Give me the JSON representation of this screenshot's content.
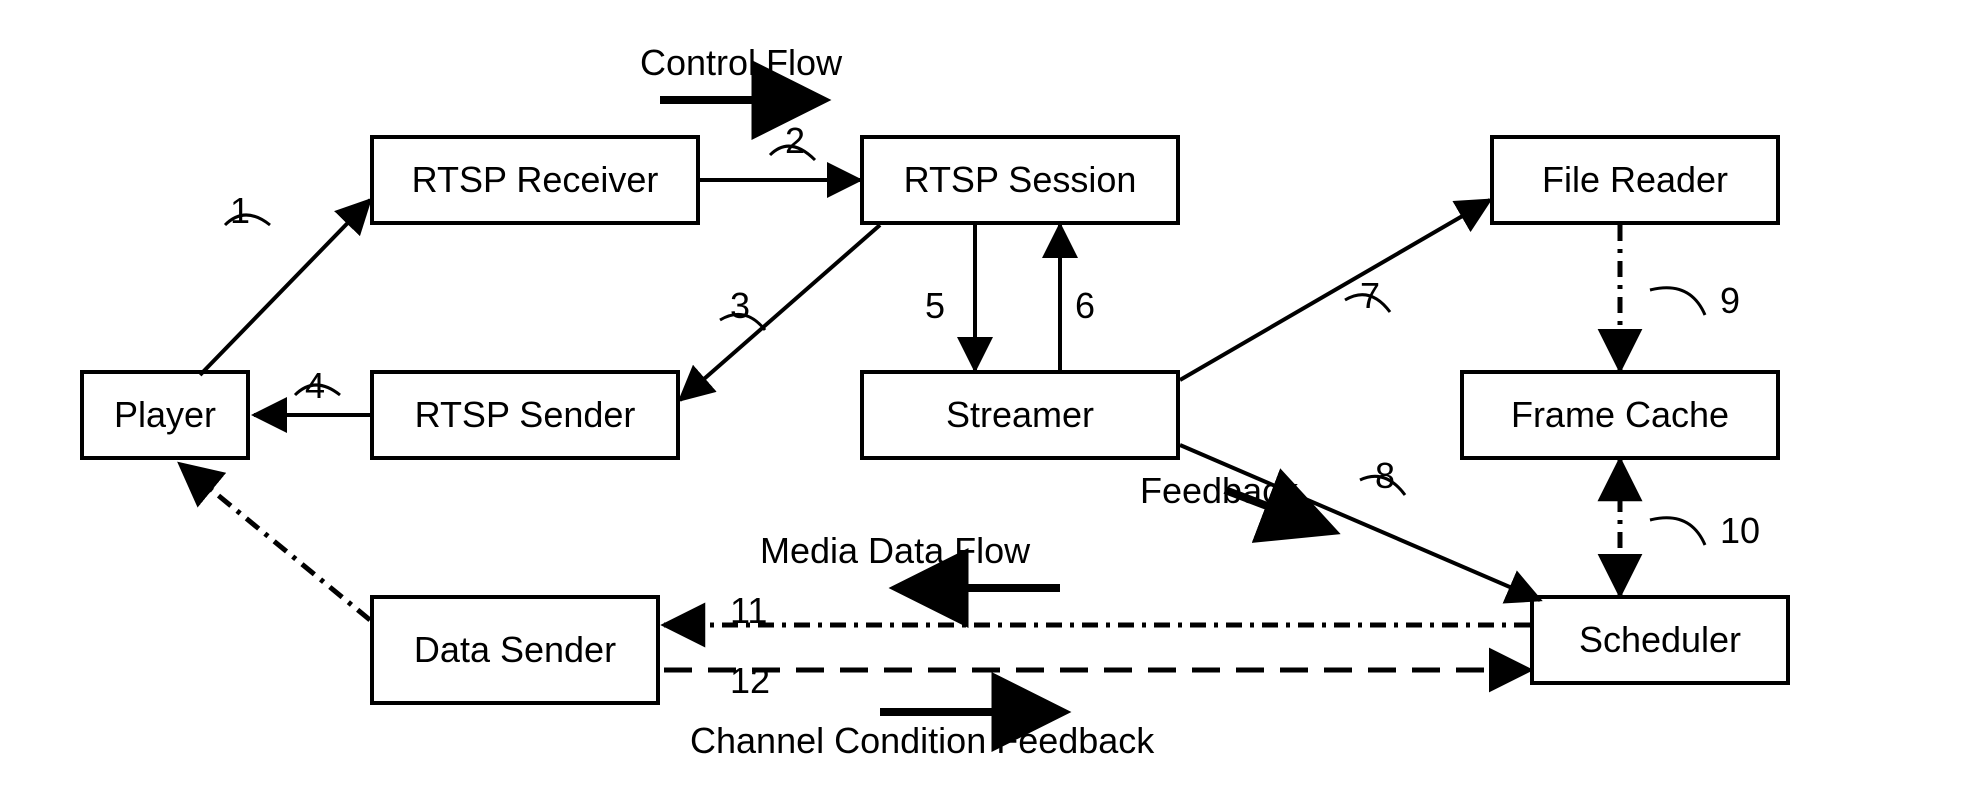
{
  "nodes": {
    "player": "Player",
    "rtsp_receiver": "RTSP Receiver",
    "rtsp_sender": "RTSP Sender",
    "rtsp_session": "RTSP Session",
    "streamer": "Streamer",
    "file_reader": "File Reader",
    "frame_cache": "Frame Cache",
    "data_sender": "Data Sender",
    "scheduler": "Scheduler"
  },
  "legend": {
    "control_flow": "Control Flow",
    "media_data_flow": "Media Data Flow",
    "feedback": "Feedback",
    "channel_condition_feedback": "Channel Condition Feedback"
  },
  "edge_numbers": {
    "n1": "1",
    "n2": "2",
    "n3": "3",
    "n4": "4",
    "n5": "5",
    "n6": "6",
    "n7": "7",
    "n8": "8",
    "n9": "9",
    "n10": "10",
    "n11": "11",
    "n12": "12"
  }
}
